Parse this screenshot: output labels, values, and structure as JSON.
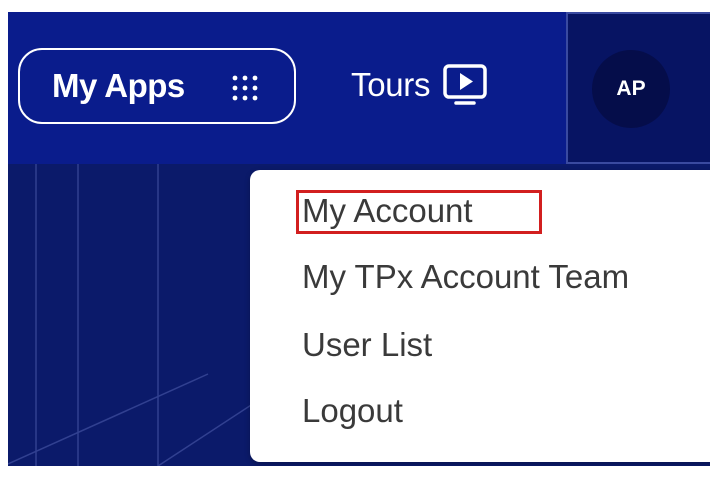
{
  "header": {
    "my_apps_label": "My Apps",
    "tours_label": "Tours",
    "avatar_initials": "AP"
  },
  "user_menu": {
    "items": [
      {
        "label": "My Account",
        "highlighted": true
      },
      {
        "label": "My TPx Account Team"
      },
      {
        "label": "User List"
      },
      {
        "label": "Logout"
      }
    ],
    "highlight_color": "#d21f1f"
  },
  "colors": {
    "header_bg": "#0a1c8c",
    "avatar_area_bg": "#071463",
    "menu_text": "#3a3a3a"
  },
  "icons": {
    "apps": "grid-dots-icon",
    "tours": "play-screen-icon"
  }
}
